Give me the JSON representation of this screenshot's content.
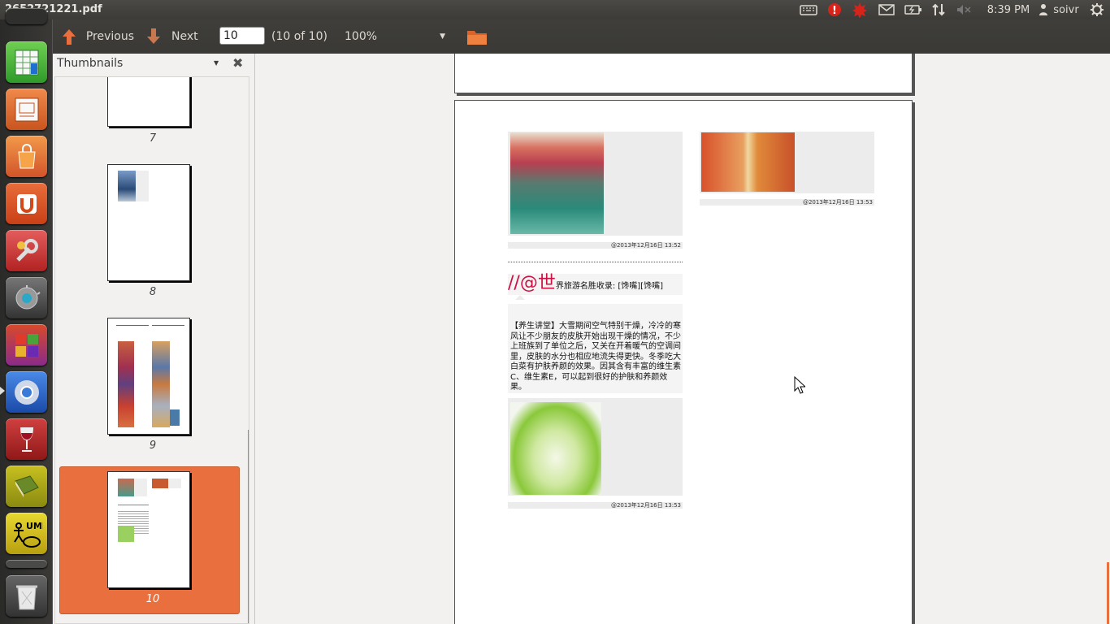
{
  "window": {
    "title": "2652721221.pdf"
  },
  "indicators": {
    "time": "8:39 PM",
    "user": "soivr"
  },
  "toolbar": {
    "previous_label": "Previous",
    "next_label": "Next",
    "page_value": "10",
    "page_count": "(10 of 10)",
    "zoom": "100%"
  },
  "sidebar": {
    "title": "Thumbnails",
    "thumbnails": [
      {
        "label": "7"
      },
      {
        "label": "8"
      },
      {
        "label": "9"
      },
      {
        "label": "10",
        "selected": true
      }
    ]
  },
  "document": {
    "caption_1": "@2013年12月16日 13:52",
    "caption_2": "@2013年12月16日 13:53",
    "caption_3": "@2013年12月16日 13:53",
    "heading_accent": "//@世",
    "heading_rest": "界旅游名胜收录: [馋嘴][馋嘴]",
    "article_text": "【养生讲堂】大雪期间空气特别干燥，冷冷的寒风让不少朋友的皮肤开始出现干燥的情况，不少上班族到了单位之后，又关在开着暖气的空调间里，皮肤的水分也相应地流失得更快。冬季吃大白菜有护肤养颜的效果。因其含有丰富的维生素C、维生素E，可以起到很好的护肤和养颜效果。"
  },
  "colors": {
    "accent": "#e9703e",
    "heading_red": "#cc1144",
    "panel": "#f2f1f0"
  }
}
